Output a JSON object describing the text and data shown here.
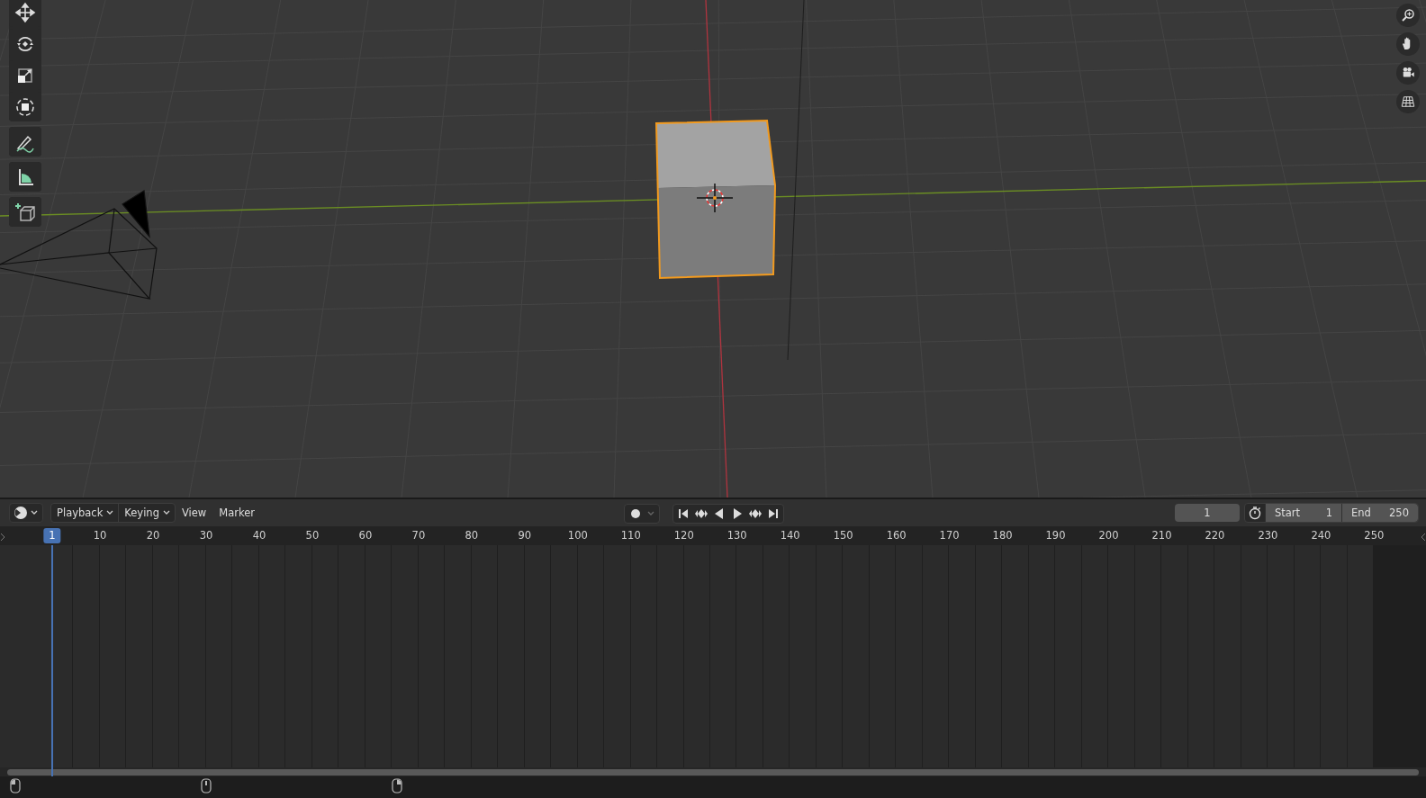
{
  "viewport": {
    "tools": [
      {
        "kind": "move"
      },
      {
        "kind": "rotate"
      },
      {
        "kind": "scale"
      },
      {
        "kind": "transform"
      },
      {
        "kind": "annotate"
      },
      {
        "kind": "measure"
      },
      {
        "kind": "add-cube"
      }
    ],
    "navigation": [
      {
        "kind": "zoom"
      },
      {
        "kind": "pan"
      },
      {
        "kind": "camera"
      },
      {
        "kind": "grid"
      }
    ]
  },
  "timeline": {
    "menus": [
      {
        "label": "Playback",
        "kind": "dropdown"
      },
      {
        "label": "Keying",
        "kind": "dropdown"
      },
      {
        "label": "View",
        "kind": "menu"
      },
      {
        "label": "Marker",
        "kind": "menu"
      }
    ],
    "current_frame": "1",
    "start": {
      "label": "Start",
      "value": "1"
    },
    "end": {
      "label": "End",
      "value": "250"
    },
    "frames": [
      {
        "label": "1",
        "current": true
      },
      {
        "label": "10",
        "current": false
      },
      {
        "label": "20",
        "current": false
      },
      {
        "label": "30",
        "current": false
      },
      {
        "label": "40",
        "current": false
      },
      {
        "label": "50",
        "current": false
      },
      {
        "label": "60",
        "current": false
      },
      {
        "label": "70",
        "current": false
      },
      {
        "label": "80",
        "current": false
      },
      {
        "label": "90",
        "current": false
      },
      {
        "label": "100",
        "current": false
      },
      {
        "label": "110",
        "current": false
      },
      {
        "label": "120",
        "current": false
      },
      {
        "label": "130",
        "current": false
      },
      {
        "label": "140",
        "current": false
      },
      {
        "label": "150",
        "current": false
      },
      {
        "label": "160",
        "current": false
      },
      {
        "label": "170",
        "current": false
      },
      {
        "label": "180",
        "current": false
      },
      {
        "label": "190",
        "current": false
      },
      {
        "label": "200",
        "current": false
      },
      {
        "label": "210",
        "current": false
      },
      {
        "label": "220",
        "current": false
      },
      {
        "label": "230",
        "current": false
      },
      {
        "label": "240",
        "current": false
      },
      {
        "label": "250",
        "current": false
      }
    ]
  }
}
